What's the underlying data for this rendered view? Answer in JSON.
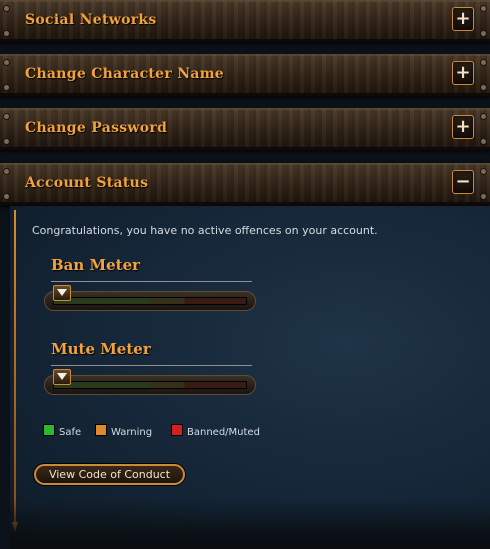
{
  "sections": [
    {
      "title": "Social Networks",
      "toggle": "+"
    },
    {
      "title": "Change Character Name",
      "toggle": "+"
    },
    {
      "title": "Change Password",
      "toggle": "+"
    },
    {
      "title": "Account Status",
      "toggle": "−"
    }
  ],
  "account_status": {
    "message": "Congratulations, you have no active offences on your account.",
    "ban_meter": {
      "label": "Ban Meter",
      "level": 0
    },
    "mute_meter": {
      "label": "Mute Meter",
      "level": 0
    },
    "legend": [
      {
        "label": "Safe",
        "color": "#2db82d"
      },
      {
        "label": "Warning",
        "color": "#e0892a"
      },
      {
        "label": "Banned/Muted",
        "color": "#d42020"
      }
    ],
    "conduct_button": "View Code of Conduct"
  },
  "colors": {
    "accent": "#f2a23c",
    "border": "#c98a3a"
  }
}
